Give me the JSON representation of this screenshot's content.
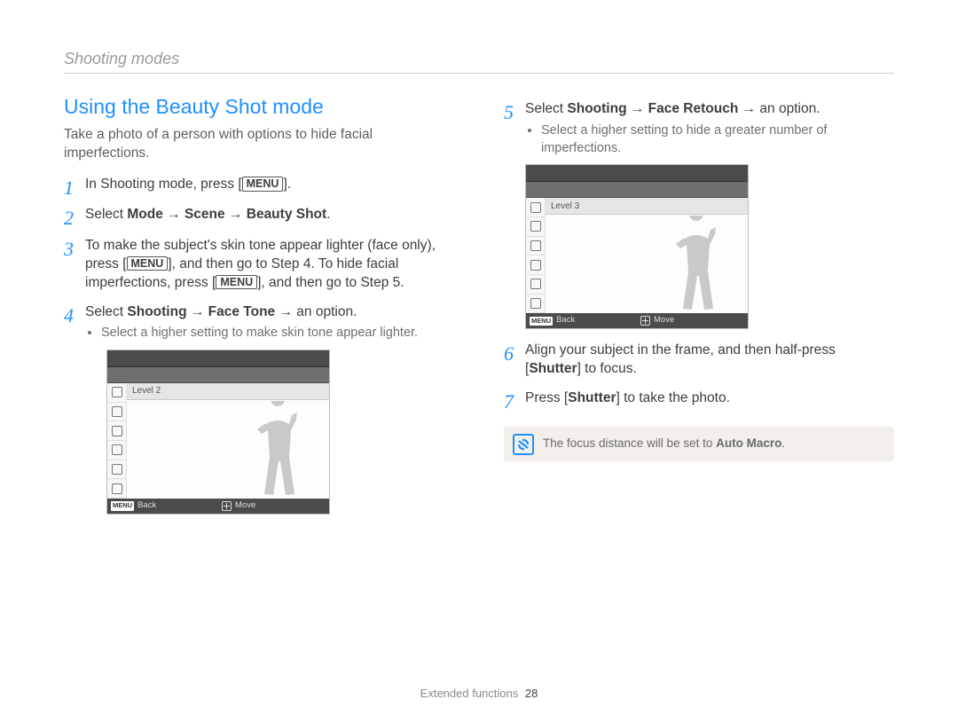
{
  "header": {
    "section": "Shooting modes"
  },
  "title": "Using the Beauty Shot mode",
  "intro": "Take a photo of a person with options to hide facial imperfections.",
  "labels": {
    "menu": "MENU",
    "back": "Back",
    "move": "Move"
  },
  "steps": {
    "s1a": "In Shooting mode, press [",
    "s1b": "].",
    "s2a": "Select ",
    "s2b": "Mode → Scene → Beauty Shot",
    "s2c": ".",
    "s3a": "To make the subject's skin tone appear lighter (face only), press [",
    "s3b": "], and then go to Step 4. To hide facial imperfections, press [",
    "s3c": "], and then go to Step 5.",
    "s4a": "Select ",
    "s4b": "Shooting → Face Tone",
    "s4c": " → an option.",
    "s4_sub": "Select a higher setting to make skin tone appear lighter.",
    "screen1_level": "Level 2",
    "s5a": "Select ",
    "s5b": "Shooting → Face Retouch",
    "s5c": " → an option.",
    "s5_sub": "Select a higher setting to hide a greater number of imperfections.",
    "screen2_level": "Level 3",
    "s6a": "Align your subject in the frame, and then half-press [",
    "s6b": "Shutter",
    "s6c": "] to focus.",
    "s7a": "Press [",
    "s7b": "Shutter",
    "s7c": "] to take the photo."
  },
  "note": {
    "pre": "The focus distance will be set to ",
    "strong": "Auto Macro",
    "post": "."
  },
  "footer": {
    "label": "Extended functions",
    "page": "28"
  }
}
